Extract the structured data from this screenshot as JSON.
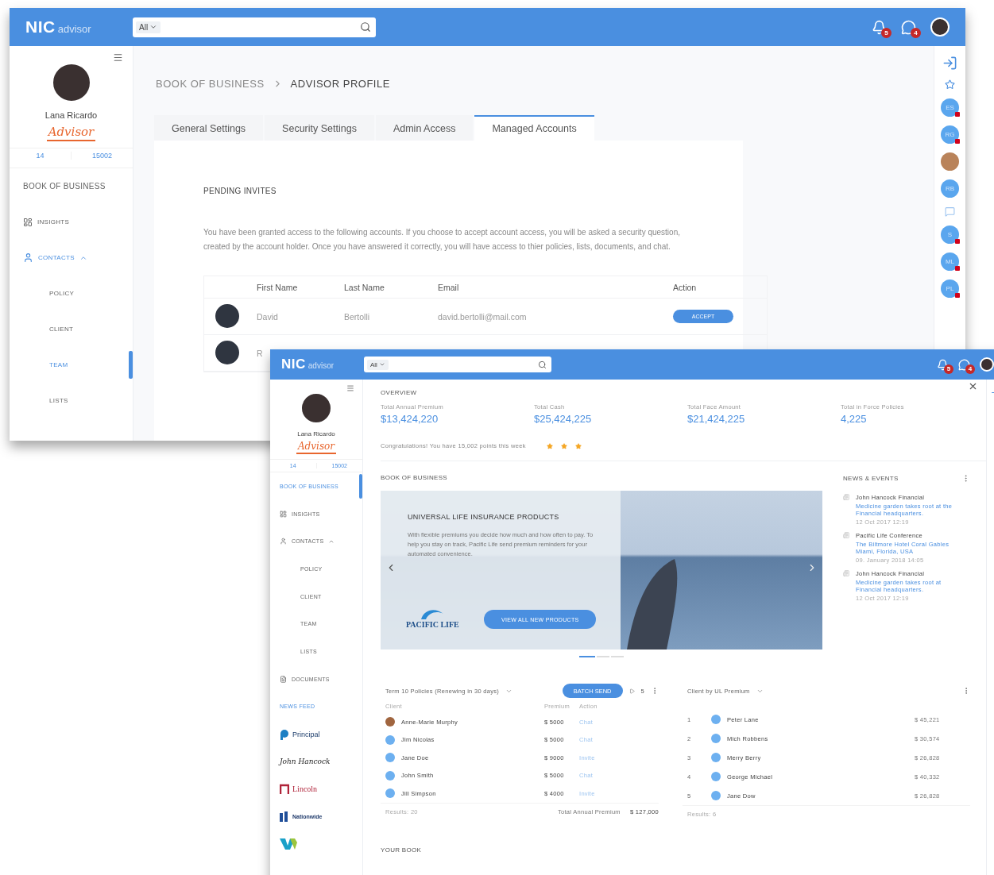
{
  "back_window": {
    "header": {
      "logo": "NIC",
      "logo_sub": "advisor",
      "search_filter": "All",
      "bell_badge": "5",
      "chat_badge": "4"
    },
    "sidebar": {
      "user_name": "Lana Ricardo",
      "role": "Advisor",
      "stats": [
        "14",
        "15002"
      ],
      "nav": [
        {
          "label": "BOOK OF BUSINESS",
          "kind": "heading",
          "selected": false
        },
        {
          "label": "INSIGHTS",
          "kind": "chart",
          "selected": false
        },
        {
          "label": "CONTACTS",
          "kind": "person",
          "selected": false,
          "expanded": true,
          "children": [
            {
              "label": "POLICY",
              "selected": false
            },
            {
              "label": "CLIENT",
              "selected": false
            },
            {
              "label": "TEAM",
              "selected": true
            },
            {
              "label": "LISTS",
              "selected": false
            }
          ]
        }
      ]
    },
    "breadcrumb": [
      "BOOK OF BUSINESS",
      "ADVISOR PROFILE"
    ],
    "tabs": [
      {
        "label": "General Settings",
        "selected": false
      },
      {
        "label": "Security Settings",
        "selected": false
      },
      {
        "label": "Admin Access",
        "selected": false
      },
      {
        "label": "Managed Accounts",
        "selected": true
      }
    ],
    "section_title": "PENDING INVITES",
    "intro": "You have been granted access to the following accounts. If you choose to accept account access, you will be asked a security question, created by the account holder. Once you have answered it correctly, you will have access to thier policies, lists, documents, and chat.",
    "table": {
      "columns": [
        "First Name",
        "Last Name",
        "Email",
        "Action"
      ],
      "rows": [
        {
          "first_name": "David",
          "last_name": "Bertolli",
          "email": "david.bertolli@mail.com",
          "action": "ACCEPT"
        },
        {
          "first_name": "R"
        }
      ]
    },
    "rail": [
      {
        "kind": "expand"
      },
      {
        "kind": "star"
      },
      {
        "kind": "initials",
        "initials": "ES",
        "alert": true
      },
      {
        "kind": "initials",
        "initials": "RG",
        "alert": true
      },
      {
        "kind": "photo",
        "alert": false
      },
      {
        "kind": "initials",
        "initials": "RB",
        "alert": false
      },
      {
        "kind": "chat"
      },
      {
        "kind": "initials",
        "initials": "S",
        "alert": true
      },
      {
        "kind": "initials",
        "initials": "ML",
        "alert": true
      },
      {
        "kind": "initials",
        "initials": "PL",
        "alert": true
      }
    ]
  },
  "front_window": {
    "header": {
      "logo": "NIC",
      "logo_sub": "advisor",
      "search_filter": "All",
      "bell_badge": "5",
      "chat_badge": "4"
    },
    "sidebar": {
      "user_name": "Lana Ricardo",
      "role": "Advisor",
      "stats": [
        "14",
        "15002"
      ],
      "nav": [
        {
          "label": "BOOK OF BUSINESS",
          "kind": "heading",
          "selected": true
        },
        {
          "label": "INSIGHTS",
          "kind": "chart",
          "selected": false
        },
        {
          "label": "CONTACTS",
          "kind": "person",
          "selected": false,
          "expanded": true,
          "children": [
            {
              "label": "POLICY",
              "selected": false
            },
            {
              "label": "CLIENT",
              "selected": false
            },
            {
              "label": "TEAM",
              "selected": false
            },
            {
              "label": "LISTS",
              "selected": false
            }
          ]
        },
        {
          "label": "DOCUMENTS",
          "kind": "file",
          "selected": false
        },
        {
          "label": "NEWS FEED",
          "kind": "section",
          "selected": false
        }
      ],
      "logos": [
        {
          "kind": "principal",
          "name": "Principal"
        },
        {
          "kind": "signature",
          "name": "John Hancock"
        },
        {
          "kind": "lincoln",
          "name": "Lincoln"
        },
        {
          "kind": "nationwide",
          "name": "Nationwide"
        },
        {
          "kind": "w-mark"
        }
      ]
    },
    "overview": {
      "title": "OVERVIEW",
      "stats": [
        {
          "label": "Total Annual Premium",
          "value": "$13,424,220"
        },
        {
          "label": "Total Cash",
          "value": "$25,424,225"
        },
        {
          "label": "Total Face Amount",
          "value": "$21,424,225"
        },
        {
          "label": "Total in Force Policies",
          "value": "4,225"
        }
      ],
      "congrats": "Congratulations! You have 15,002 points this week",
      "stars": 3
    },
    "book_title": "BOOK OF BUSINESS",
    "banner": {
      "title": "UNIVERSAL LIFE INSURANCE PRODUCTS",
      "text": "With flexible premiums you decide how much and how often to pay. To help you stay on track, Pacific Life send premium reminders for your automated convenience.",
      "logo": "PACIFIC LIFE",
      "button": "VIEW ALL NEW PRODUCTS",
      "slides": [
        {
          "selected": true
        },
        {
          "selected": false
        },
        {
          "selected": false
        }
      ]
    },
    "news": {
      "title": "NEWS & EVENTS",
      "items": [
        {
          "source": "John Hancock Financial",
          "text": "Medicine garden takes root at the Financial headquarters.",
          "date": "12 Oct 2017 12:19"
        },
        {
          "source": "Pacific Life Conference",
          "text": "The Biltmore Hotel Coral Gables Miami, Florida, USA",
          "date": "09. January 2018 14:05"
        },
        {
          "source": "John Hancock Financial",
          "text": "Medicine garden takes root at Financial headquarters.",
          "date": "12 Oct 2017 12:19"
        }
      ]
    },
    "term_table": {
      "title": "Term 10 Policies (Renewing in 30 days)",
      "button": "BATCH SEND",
      "count": "5",
      "columns": [
        "Client",
        "Premium",
        "Action"
      ],
      "rows": [
        {
          "kind": "photo",
          "name": "Anne-Marie Murphy",
          "premium": "$ 5000",
          "action": "Chat"
        },
        {
          "kind": "initials",
          "name": "Jim Nicolas",
          "premium": "$ 5000",
          "action": "Chat"
        },
        {
          "kind": "initials",
          "name": "Jane Doe",
          "premium": "$ 9000",
          "action": "Invite"
        },
        {
          "kind": "initials",
          "name": "John Smith",
          "premium": "$ 5000",
          "action": "Chat"
        },
        {
          "kind": "initials",
          "name": "Jill Simpson",
          "premium": "$ 4000",
          "action": "Invite"
        }
      ],
      "results": "Results: 20",
      "total_label": "Total Annual Premium",
      "total": "$ 127,000"
    },
    "client_table": {
      "title": "Client by UL Premium",
      "rows": [
        {
          "rank": "1",
          "name": "Peter Lane",
          "amount": "$ 45,221"
        },
        {
          "rank": "2",
          "name": "Mich Robbens",
          "amount": "$ 30,574"
        },
        {
          "rank": "3",
          "name": "Merry Berry",
          "amount": "$ 26,828"
        },
        {
          "rank": "4",
          "name": "George Michael",
          "amount": "$ 40,332"
        },
        {
          "rank": "5",
          "name": "Jane Dow",
          "amount": "$ 26,828"
        }
      ],
      "results": "Results: 6"
    },
    "your_book": "YOUR BOOK"
  }
}
